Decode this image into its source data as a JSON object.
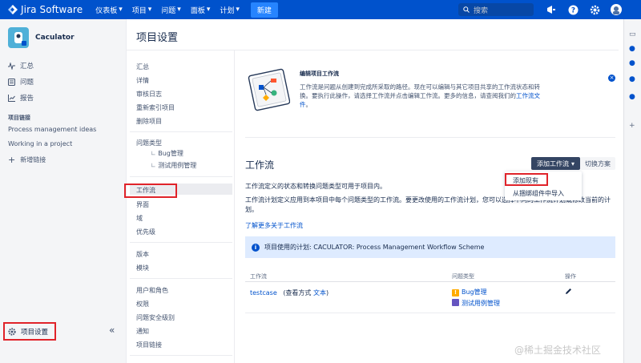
{
  "header": {
    "brand": "Jira Software",
    "menu": [
      "仪表板",
      "项目",
      "问题",
      "面板",
      "计划"
    ],
    "create": "新建",
    "search_placeholder": "搜索",
    "colors": {
      "bar": "#0052cc",
      "create": "#2684ff"
    }
  },
  "project": {
    "name": "Caculator"
  },
  "sidebar": {
    "nav": [
      "汇总",
      "问题",
      "报告"
    ],
    "section_title": "项目链接",
    "links": [
      "Process management ideas",
      "Working in a project"
    ],
    "add_link": "新增链接",
    "settings": "项目设置",
    "collapse": "«"
  },
  "settings": {
    "title": "项目设置",
    "group1": [
      "汇总",
      "详情",
      "审核日志",
      "重新索引项目",
      "删除项目"
    ],
    "issue_types": "问题类型",
    "issue_type_children": [
      "Bug管理",
      "测试用例管理"
    ],
    "group2": [
      "工作流",
      "界面",
      "域",
      "优先级"
    ],
    "group3": [
      "版本",
      "模块"
    ],
    "group4": [
      "用户和角色",
      "权限",
      "问题安全级别",
      "通知",
      "项目链接"
    ]
  },
  "intro": {
    "title": "编辑项目工作流",
    "text_lines": [
      "工作流是问题从创建到完成所采取的路径。现在可以编辑与其它项目共享的工作流状态和转",
      "换。要执行此操作，请选择工作流并点击编辑工作流。更多的信息，请查阅我们的"
    ],
    "link": "工作流文",
    "link_tail": "件",
    "tail": "。"
  },
  "workflow": {
    "heading": "工作流",
    "add_button": "添加工作流",
    "switch_button": "切换方案",
    "dropdown": [
      "添加现有",
      "从捆绑组件中导入"
    ],
    "desc1": "工作流定义的状态和转换问题类型可用于项目内。",
    "desc2": "工作流计划定义应用到本项目中每个问题类型的工作流。要更改使用的工作流计划，您可以选择不同的工作流计划或修改当前的计",
    "desc2_tail": "划。",
    "learn_more": "了解更多关于工作流",
    "scheme_info": "项目使用的计划: CACULATOR: Process Management Workflow Scheme",
    "table": {
      "headers": [
        "工作流",
        "问题类型",
        "操作"
      ],
      "row": {
        "name": "testcase",
        "view_prefix": "(查看方式",
        "view_link": "文本",
        "view_suffix": ")",
        "issue_types": [
          "Bug管理",
          "测试用例管理"
        ]
      }
    }
  },
  "watermark": "@稀土掘金技术社区"
}
